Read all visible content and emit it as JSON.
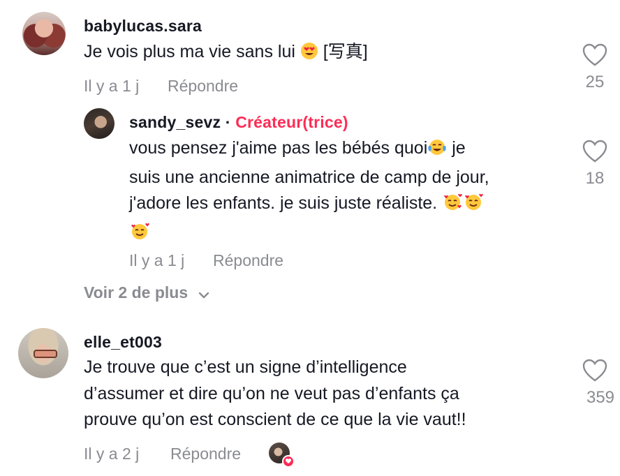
{
  "comments": [
    {
      "username": "babylucas.sara",
      "line1": "Je vois plus ma vie sans lui ",
      "line1_suffix": " [写真]",
      "time": "Il y a 1 j",
      "reply": "Répondre",
      "likes": "25",
      "emoji": [
        "heart-eyes-emoji"
      ]
    },
    {
      "username": "sandy_sevz",
      "separator": "·",
      "badge": "Créateur(trice)",
      "lines": [
        "vous pensez j'aime pas les bébés quoi",
        " je",
        "suis une ancienne animatrice de camp de jour,",
        "j'adore les enfants. je suis juste réaliste. "
      ],
      "time": "Il y a 1 j",
      "reply": "Répondre",
      "likes": "18",
      "emoji": [
        "tears-of-joy-emoji",
        "smiling-hearts-emoji"
      ]
    },
    {
      "username": "elle_et003",
      "lines": [
        "Je trouve que c’est un signe d’intelligence",
        "d’assumer et dire qu’on ne veut pas d’enfants ça",
        "prouve qu’on est conscient de ce que la vie vaut!!"
      ],
      "time": "Il y a 2 j",
      "reply": "Répondre",
      "likes": "359"
    }
  ],
  "more_replies": "Voir 2 de plus",
  "colors": {
    "accent": "#fe2c55",
    "muted": "#8a8b91",
    "text": "#161823"
  },
  "icons": [
    "heart-outline-icon",
    "chevron-down-icon",
    "creator-liked-badge-icon"
  ]
}
